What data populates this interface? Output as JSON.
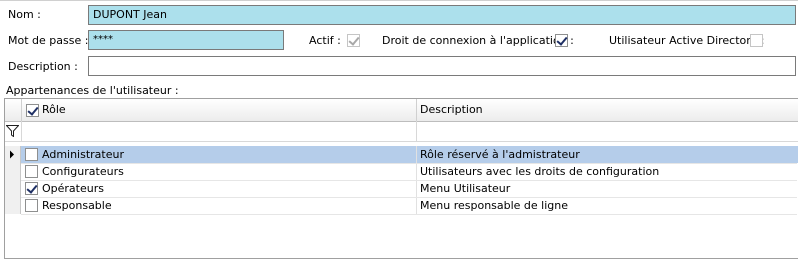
{
  "form": {
    "nom_label": "Nom :",
    "nom_value": "DUPONT Jean",
    "password_label": "Mot de passe :",
    "password_value": "****",
    "actif_label": "Actif :",
    "actif_checked": true,
    "droit_label": "Droit de connexion à l'application :",
    "droit_checked": true,
    "ad_label": "Utilisateur Active Directory :",
    "ad_checked": false,
    "description_label": "Description :",
    "description_value": ""
  },
  "grid": {
    "section_label": "Appartenances de l'utilisateur :",
    "columns": [
      "Rôle",
      "Description"
    ],
    "header_checked": true,
    "filter_icon": "filter-icon",
    "rows": [
      {
        "role": "Administrateur",
        "description": "Rôle réservé à l'admistrateur",
        "checked": false,
        "selected": true
      },
      {
        "role": "Configurateurs",
        "description": "Utilisateurs avec les droits de configuration",
        "checked": false,
        "selected": false
      },
      {
        "role": "Opérateurs",
        "description": "Menu Utilisateur",
        "checked": true,
        "selected": false
      },
      {
        "role": "Responsable",
        "description": "Menu responsable de ligne",
        "checked": false,
        "selected": false
      }
    ]
  },
  "colors": {
    "field_blue": "#ace0ec",
    "selection": "#b5cdea"
  }
}
